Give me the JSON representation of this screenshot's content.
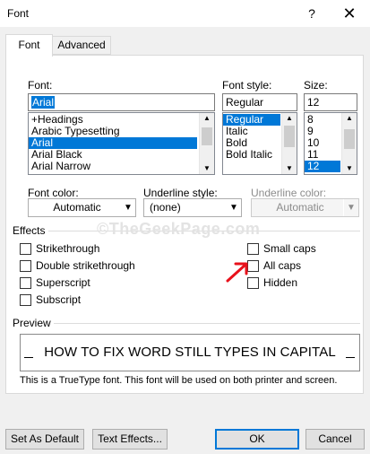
{
  "window": {
    "title": "Font",
    "help_icon": "question-mark-icon",
    "close_icon": "close-icon"
  },
  "tabs": [
    {
      "label": "Font",
      "active": true
    },
    {
      "label": "Advanced",
      "active": false
    }
  ],
  "font": {
    "label": "Font:",
    "value": "Arial",
    "list": [
      "+Headings",
      "Arabic Typesetting",
      "Arial",
      "Arial Black",
      "Arial Narrow"
    ],
    "selected": "Arial"
  },
  "font_style": {
    "label": "Font style:",
    "value": "Regular",
    "list": [
      "Regular",
      "Italic",
      "Bold",
      "Bold Italic"
    ],
    "selected": "Regular"
  },
  "size": {
    "label": "Size:",
    "value": "12",
    "list": [
      "8",
      "9",
      "10",
      "11",
      "12"
    ],
    "selected": "12"
  },
  "font_color": {
    "label": "Font color:",
    "value": "Automatic"
  },
  "underline_style": {
    "label": "Underline style:",
    "value": "(none)"
  },
  "underline_color": {
    "label": "Underline color:",
    "value": "Automatic",
    "disabled": true
  },
  "effects": {
    "label": "Effects",
    "left": [
      {
        "label": "Strikethrough",
        "checked": false
      },
      {
        "label": "Double strikethrough",
        "checked": false
      },
      {
        "label": "Superscript",
        "checked": false
      },
      {
        "label": "Subscript",
        "checked": false
      }
    ],
    "right": [
      {
        "label": "Small caps",
        "checked": false
      },
      {
        "label": "All caps",
        "checked": false
      },
      {
        "label": "Hidden",
        "checked": false
      }
    ]
  },
  "preview": {
    "label": "Preview",
    "text": "HOW TO FIX WORD STILL TYPES IN CAPITAL",
    "note": "This is a TrueType font. This font will be used on both printer and screen."
  },
  "buttons": {
    "set_default": "Set As Default",
    "text_effects": "Text Effects...",
    "ok": "OK",
    "cancel": "Cancel"
  },
  "watermark": "©TheGeekPage.com",
  "colors": {
    "selection": "#0078d7",
    "annotation_arrow": "#e8111b",
    "ok_border": "#0078d7"
  }
}
